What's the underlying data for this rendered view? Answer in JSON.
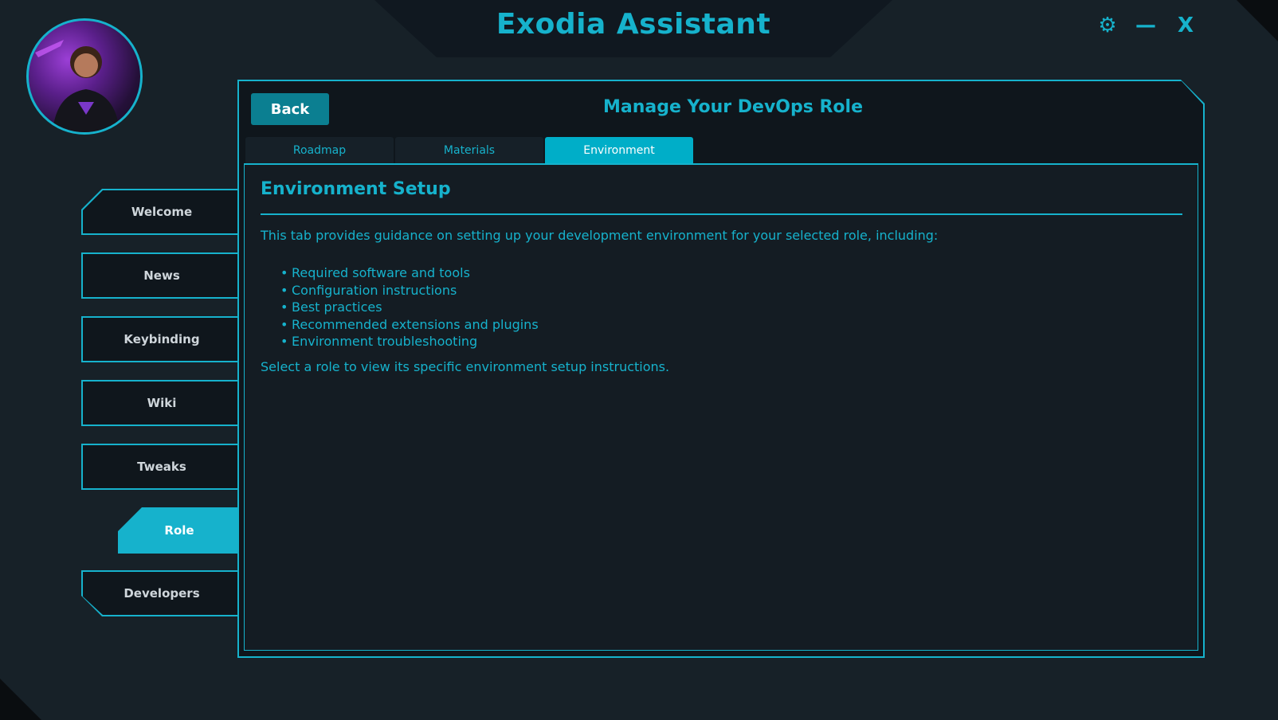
{
  "app": {
    "title": "Exodia Assistant",
    "accent_color": "#16b2cc"
  },
  "window_controls": {
    "settings_icon": "⚙",
    "minimize_icon": "—",
    "close_icon": "X"
  },
  "sidebar": {
    "items": [
      {
        "label": "Welcome"
      },
      {
        "label": "News"
      },
      {
        "label": "Keybinding"
      },
      {
        "label": "Wiki"
      },
      {
        "label": "Tweaks"
      },
      {
        "label": "Role",
        "active": true
      },
      {
        "label": "Developers"
      }
    ]
  },
  "panel": {
    "back_label": "Back",
    "title": "Manage Your DevOps Role",
    "tabs": [
      {
        "label": "Roadmap"
      },
      {
        "label": "Materials"
      },
      {
        "label": "Environment",
        "active": true
      }
    ]
  },
  "content": {
    "heading": "Environment Setup",
    "intro": "This tab provides guidance on setting up your development environment for your selected role, including:",
    "bullet_char": "•",
    "bullets": [
      "Required software and tools",
      "Configuration instructions",
      "Best practices",
      "Recommended extensions and plugins",
      "Environment troubleshooting"
    ],
    "footer": "Select a role to view its specific environment setup instructions."
  }
}
